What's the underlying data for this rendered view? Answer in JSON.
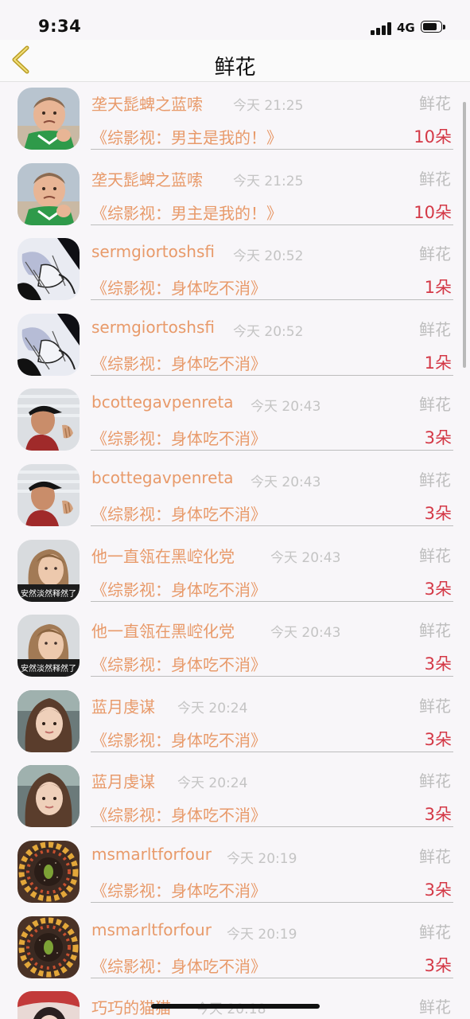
{
  "status_bar": {
    "time": "9:34",
    "network": "4G"
  },
  "nav": {
    "title": "鲜花",
    "back_icon": "chevron-left-icon",
    "accent_color": "#b99d25"
  },
  "colors": {
    "name": "#e89a6a",
    "time": "#c4c4c4",
    "gift": "#bdbdbd",
    "count": "#d43846"
  },
  "rows": [
    {
      "name": "垄天髭蜱之蓝嗦",
      "time": "今天 21:25",
      "gift": "鲜花",
      "book": "《综影视：男主是我的！》",
      "count": "10朵",
      "avatar": "baby-fist-avatar"
    },
    {
      "name": "垄天髭蜱之蓝嗦",
      "time": "今天 21:25",
      "gift": "鲜花",
      "book": "《综影视：男主是我的！》",
      "count": "10朵",
      "avatar": "baby-fist-avatar"
    },
    {
      "name": "sermgiortoshsfi",
      "time": "今天 20:52",
      "gift": "鲜花",
      "book": "《综影视：身体吃不消》",
      "count": "1朵",
      "avatar": "anime-sketch-avatar"
    },
    {
      "name": "sermgiortoshsfi",
      "time": "今天 20:52",
      "gift": "鲜花",
      "book": "《综影视：身体吃不消》",
      "count": "1朵",
      "avatar": "anime-sketch-avatar"
    },
    {
      "name": "bcottegavpenreta",
      "time": "今天 20:43",
      "gift": "鲜花",
      "book": "《综影视：身体吃不消》",
      "count": "3朵",
      "avatar": "cap-man-avatar"
    },
    {
      "name": "bcottegavpenreta",
      "time": "今天 20:43",
      "gift": "鲜花",
      "book": "《综影视：身体吃不消》",
      "count": "3朵",
      "avatar": "cap-man-avatar"
    },
    {
      "name": "他一直瓴在黑崆化党",
      "time": "今天 20:43",
      "gift": "鲜花",
      "book": "《综影视：身体吃不消》",
      "count": "3朵",
      "avatar": "girl-caption-avatar",
      "avatar_caption": "安然淡然释然了"
    },
    {
      "name": "他一直瓴在黑崆化党",
      "time": "今天 20:43",
      "gift": "鲜花",
      "book": "《综影视：身体吃不消》",
      "count": "3朵",
      "avatar": "girl-caption-avatar",
      "avatar_caption": "安然淡然释然了"
    },
    {
      "name": "蓝月虔谋",
      "time": "今天 20:24",
      "gift": "鲜花",
      "book": "《综影视：身体吃不消》",
      "count": "3朵",
      "avatar": "girl-bangs-avatar"
    },
    {
      "name": "蓝月虔谋",
      "time": "今天 20:24",
      "gift": "鲜花",
      "book": "《综影视：身体吃不消》",
      "count": "3朵",
      "avatar": "girl-bangs-avatar"
    },
    {
      "name": "msmarltforfour",
      "time": "今天 20:19",
      "gift": "鲜花",
      "book": "《综影视：身体吃不消》",
      "count": "3朵",
      "avatar": "fruit-ring-avatar"
    },
    {
      "name": "msmarltforfour",
      "time": "今天 20:19",
      "gift": "鲜花",
      "book": "《综影视：身体吃不消》",
      "count": "3朵",
      "avatar": "fruit-ring-avatar"
    },
    {
      "name": "巧巧的猫猫",
      "time": "今天 20:18",
      "gift": "鲜花",
      "book": "",
      "count": "",
      "avatar": "pink-avatar"
    }
  ]
}
